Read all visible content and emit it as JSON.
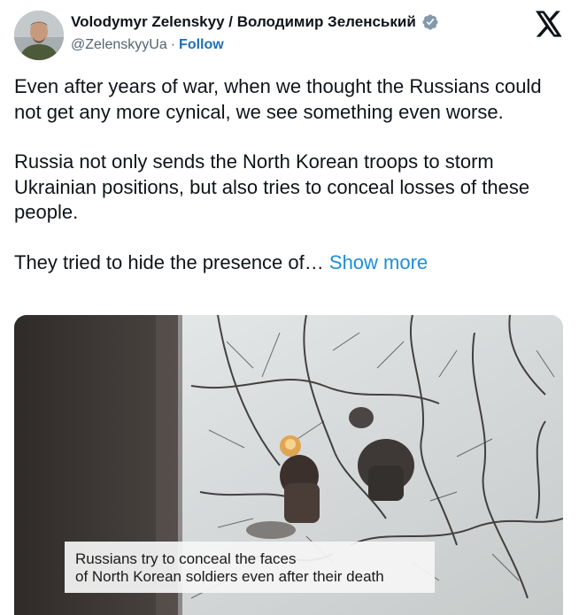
{
  "author": {
    "name": "Volodymyr Zelenskyy / Володимир Зеленський",
    "handle": "@ZelenskyyUa",
    "separator": "·",
    "follow_label": "Follow"
  },
  "icons": {
    "verified": "verified-badge-icon",
    "platform_logo": "x-logo-icon",
    "avatar": "profile-photo"
  },
  "tweet": {
    "paragraphs": [
      "Even after years of war, when we thought the Russians could not get any more cynical, we see something even worse.",
      "Russia not only sends the North Korean troops to storm Ukrainian positions, but also tries to conceal losses of these people."
    ],
    "truncated_text": "They tried to hide the presence of…",
    "show_more_label": "Show more"
  },
  "media": {
    "caption_line1": "Russians try to conceal the faces",
    "caption_line2": "of North Korean soldiers even after their death"
  },
  "colors": {
    "text": "#0f1419",
    "secondary": "#536471",
    "link": "#1d8fd8",
    "verified": "#829aab"
  }
}
